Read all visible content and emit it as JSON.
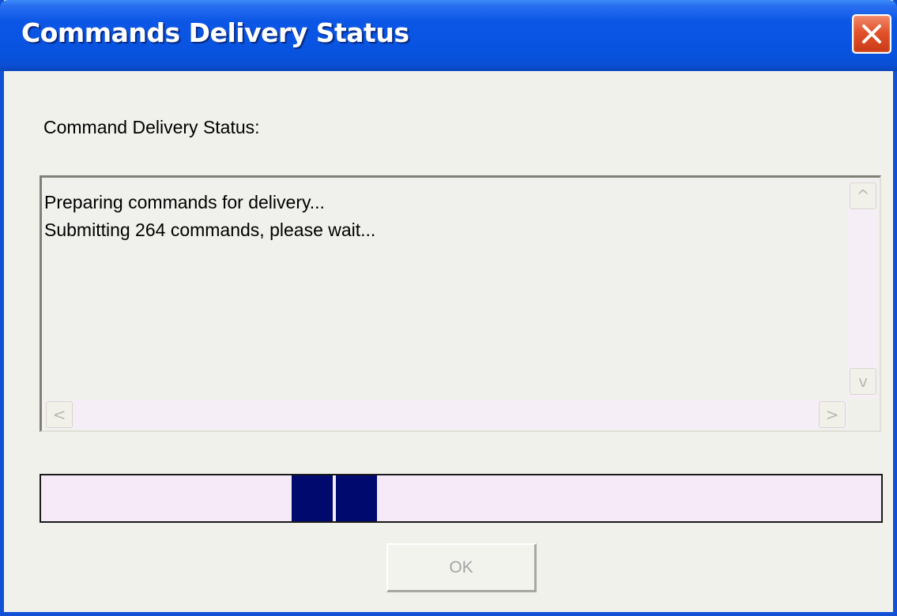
{
  "window": {
    "title": "Commands Delivery Status"
  },
  "status_label": "Command Delivery Status:",
  "log": {
    "lines": [
      "Preparing commands for delivery...",
      "Submitting 264 commands, please wait..."
    ]
  },
  "scrollbars": {
    "up_glyph": "^",
    "down_glyph": "v",
    "left_glyph": "<",
    "right_glyph": ">"
  },
  "progress": {
    "style": "marquee (indeterminate)",
    "block_color": "#00096e",
    "track_color": "#f7eaf8"
  },
  "ok_button": {
    "label": "OK",
    "enabled": false
  },
  "colors": {
    "titlebar_blue": "#0854e0",
    "close_red": "#e2522c",
    "dialog_bg": "#f1f1ec"
  }
}
